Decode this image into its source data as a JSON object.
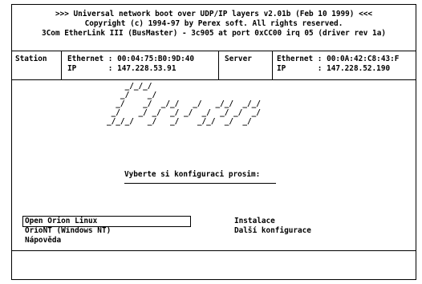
{
  "header": {
    "line1": ">>> Universal network boot over UDP/IP layers v2.01b (Feb 10 1999) <<<",
    "line2": "Copyright (c) 1994-97 by Perex soft. All rights reserved.",
    "line3": "3Com EtherLink III (BusMaster) - 3c905 at port 0xCC00 irq 05 (driver rev 1a)"
  },
  "station": {
    "label": "Station",
    "ethernet": "Ethernet : 00:04:75:B0:9D:40",
    "ip": "IP       : 147.228.53.91"
  },
  "server": {
    "label": "Server",
    "ethernet": "Ethernet : 00:0A:42:C8:43:F",
    "ip": "IP       : 147.228.52.190"
  },
  "logo": {
    "art": "    _/_/_/\n   _/    _/\n  _/    _/  _/_/   _/   _/_/  _/_/\n _/    _/ _/  _/ _/  _/  _/ _/  _/\n_/_/_/   _/   _/    _/_/  _/  _/"
  },
  "prompt": "Vyberte si konfiguraci prosim:",
  "menu": {
    "left": [
      "Open Orion Linux",
      "OrioNT (Windows NT)",
      "Nápověda"
    ],
    "right": [
      "Instalace",
      "Další konfigurace"
    ]
  }
}
